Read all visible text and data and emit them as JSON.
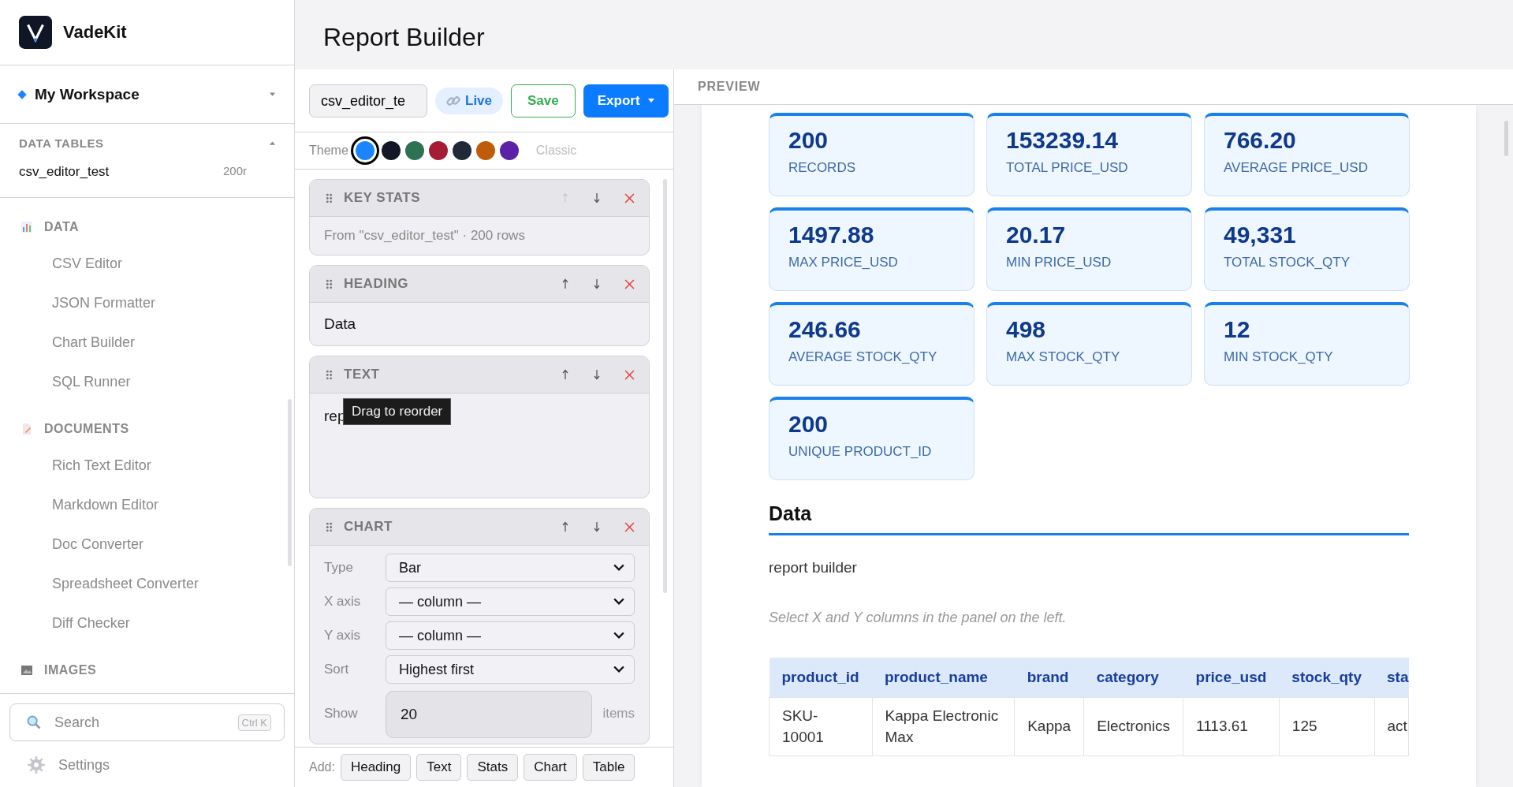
{
  "app": {
    "name": "VadeKit"
  },
  "workspace": {
    "name": "My Workspace"
  },
  "data_tables": {
    "title": "DATA TABLES",
    "expanded": true,
    "items": [
      {
        "name": "csv_editor_test",
        "count": "200r"
      }
    ]
  },
  "nav": [
    {
      "title": "DATA",
      "items": [
        "CSV Editor",
        "JSON Formatter",
        "Chart Builder",
        "SQL Runner"
      ]
    },
    {
      "title": "DOCUMENTS",
      "items": [
        "Rich Text Editor",
        "Markdown Editor",
        "Doc Converter",
        "Spreadsheet Converter",
        "Diff Checker"
      ]
    },
    {
      "title": "IMAGES"
    }
  ],
  "search": {
    "placeholder": "Search",
    "shortcut": "Ctrl K"
  },
  "settings": {
    "label": "Settings"
  },
  "page_title": "Report Builder",
  "toolbar": {
    "filename": "csv_editor_te",
    "live": "Live",
    "save": "Save",
    "export": "Export"
  },
  "theme": {
    "label": "Theme",
    "classic": "Classic",
    "swatches": [
      {
        "color": "#1a85ff",
        "selected": true
      },
      {
        "color": "#111827",
        "selected": false
      },
      {
        "color": "#2f7253",
        "selected": false
      },
      {
        "color": "#a51d34",
        "selected": false
      },
      {
        "color": "#1f2937",
        "selected": false
      },
      {
        "color": "#bf5b0a",
        "selected": false
      },
      {
        "color": "#5b21a6",
        "selected": false
      }
    ]
  },
  "blocks": [
    {
      "kind": "stats",
      "title": "KEY STATS",
      "can_move_up": false,
      "summary": "From \"csv_editor_test\" · 200 rows"
    },
    {
      "kind": "heading",
      "title": "HEADING",
      "can_move_up": true,
      "text": "Data"
    },
    {
      "kind": "text",
      "title": "TEXT",
      "can_move_up": true,
      "text": "rep"
    },
    {
      "kind": "chart",
      "title": "CHART",
      "can_move_up": true,
      "fields": [
        {
          "kind": "select",
          "label": "Type",
          "value": "Bar"
        },
        {
          "kind": "select",
          "label": "X axis",
          "value": "— column —"
        },
        {
          "kind": "select",
          "label": "Y axis",
          "value": "— column —"
        },
        {
          "kind": "select",
          "label": "Sort",
          "value": "Highest first"
        },
        {
          "kind": "number",
          "label": "Show",
          "value": "20",
          "unit": "items"
        }
      ]
    }
  ],
  "tooltip": "Drag to reorder",
  "add_bar": {
    "label": "Add:",
    "buttons": [
      "Heading",
      "Text",
      "Stats",
      "Chart",
      "Table"
    ]
  },
  "preview": {
    "label": "PREVIEW",
    "stats": [
      {
        "value": "200",
        "label": "RECORDS"
      },
      {
        "value": "153239.14",
        "label": "TOTAL PRICE_USD"
      },
      {
        "value": "766.20",
        "label": "AVERAGE PRICE_USD"
      },
      {
        "value": "1497.88",
        "label": "MAX PRICE_USD"
      },
      {
        "value": "20.17",
        "label": "MIN PRICE_USD"
      },
      {
        "value": "49,331",
        "label": "TOTAL STOCK_QTY"
      },
      {
        "value": "246.66",
        "label": "AVERAGE STOCK_QTY"
      },
      {
        "value": "498",
        "label": "MAX STOCK_QTY"
      },
      {
        "value": "12",
        "label": "MIN STOCK_QTY"
      },
      {
        "value": "200",
        "label": "UNIQUE PRODUCT_ID"
      }
    ],
    "heading": "Data",
    "text": "report builder",
    "chart_hint": "Select X and Y columns in the panel on the left.",
    "table": {
      "columns": [
        "product_id",
        "product_name",
        "brand",
        "category",
        "price_usd",
        "stock_qty",
        "sta"
      ],
      "rows": [
        [
          "SKU-10001",
          "Kappa Electronic Max",
          "Kappa",
          "Electronics",
          "1113.61",
          "125",
          "act"
        ]
      ]
    }
  }
}
